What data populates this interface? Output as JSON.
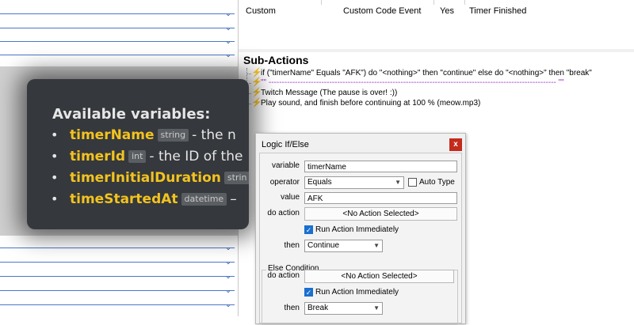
{
  "triggers": {
    "row": {
      "type": "Custom",
      "source": "Custom Code Event",
      "enabled": "Yes",
      "name": "Timer Finished"
    }
  },
  "subactions": {
    "title": "Sub-Actions",
    "items": [
      {
        "text": "if (\"timerName\" Equals \"AFK\") do \"<nothing>\" then \"continue\" else do \"<nothing>\" then \"break\"",
        "kind": "logic"
      },
      {
        "text": "\"\" ------------------------------------------------------------------------------------------------------------- \"\"",
        "kind": "comment"
      },
      {
        "text": "Twitch Message (The pause is over! :))",
        "kind": "action"
      },
      {
        "text": "Play sound, and finish before continuing at 100 % (meow.mp3)",
        "kind": "action"
      }
    ]
  },
  "tooltip": {
    "title": "Available variables:",
    "variables": [
      {
        "name": "timerName",
        "type": "string",
        "desc": "- the n"
      },
      {
        "name": "timerId",
        "type": "int",
        "desc": "- the ID of the"
      },
      {
        "name": "timerInitialDuration",
        "type": "strin",
        "desc": ""
      },
      {
        "name": "timeStartedAt",
        "type": "datetime",
        "desc": "–"
      }
    ]
  },
  "dialog": {
    "title": "Logic If/Else",
    "close_label": "x",
    "variable_label": "variable",
    "variable_value": "timerName",
    "operator_label": "operator",
    "operator_value": "Equals",
    "auto_type_label": "Auto Type",
    "value_label": "value",
    "value_value": "AFK",
    "do_action_label": "do action",
    "do_action_value": "<No Action Selected>",
    "run_immediately_label": "Run Action Immediately",
    "then_label": "then",
    "then_value": "Continue",
    "else_title": "Else Condition",
    "else_do_action_label": "do action",
    "else_do_action_value": "<No Action Selected>",
    "else_run_immediately_label": "Run Action Immediately",
    "else_then_label": "then",
    "else_then_value": "Break"
  },
  "colors": {
    "accent_blue": "#1a6fcf",
    "tooltip_bg": "#35383c",
    "variable_name": "#f2c320",
    "comment": "#9933cc",
    "close_red": "#c42b1c"
  }
}
